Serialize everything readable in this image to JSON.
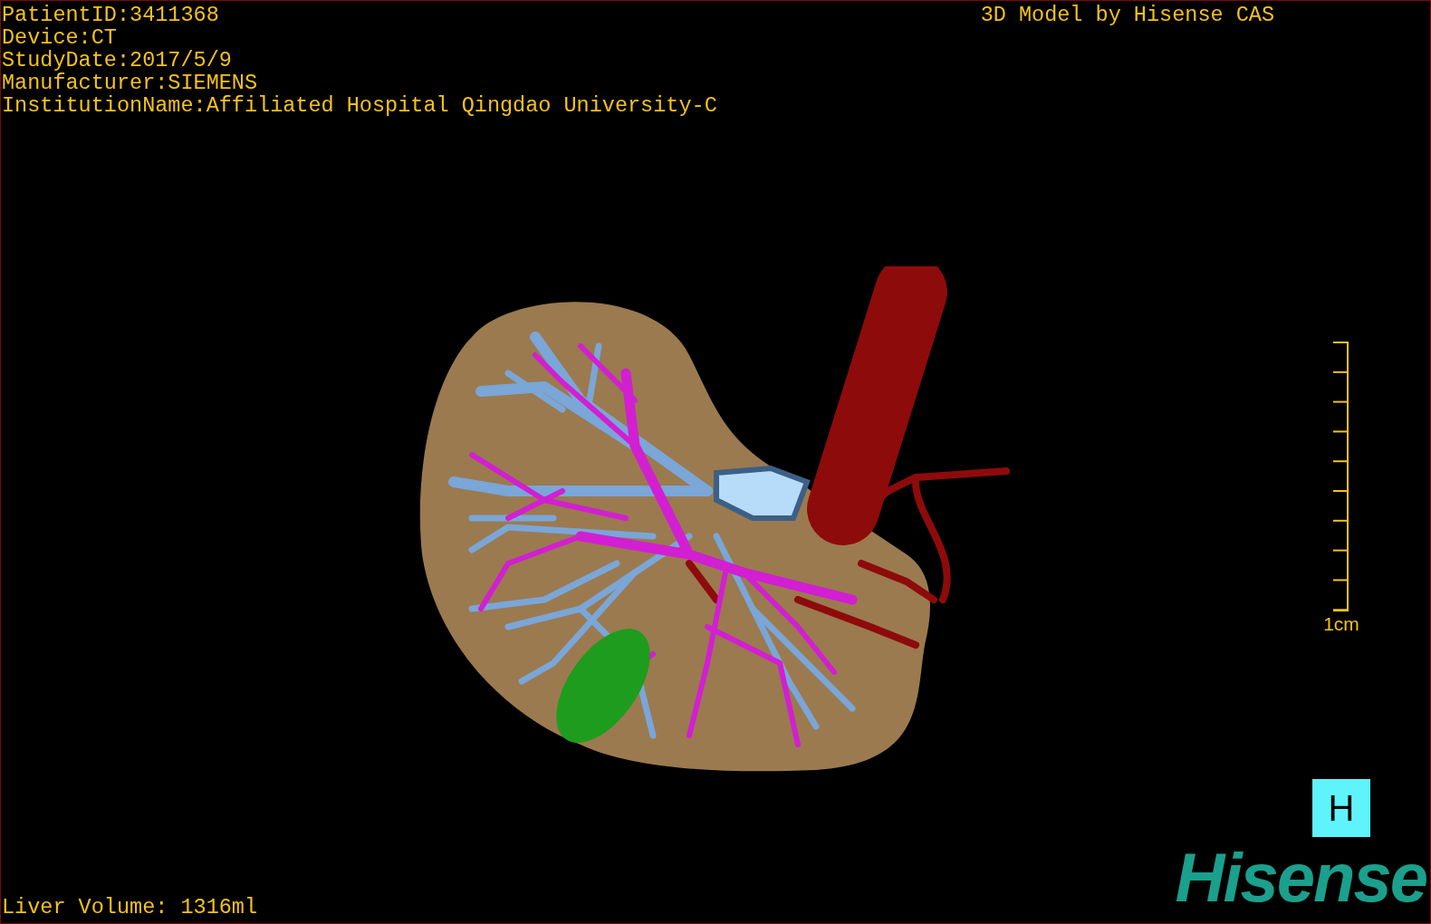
{
  "viewport": {
    "patient_info": [
      "PatientID:3411368",
      "Device:CT",
      "StudyDate:2017/5/9",
      "Manufacturer:SIEMENS",
      "InstitutionName:Affiliated Hospital Qingdao University-C"
    ],
    "title": "3D Model by Hisense CAS",
    "scale_bar": {
      "label": "1cm"
    },
    "orientation_marker": {
      "label": "H"
    },
    "liver_volume": "Liver Volume: 1316ml",
    "logo": "Hisense"
  }
}
